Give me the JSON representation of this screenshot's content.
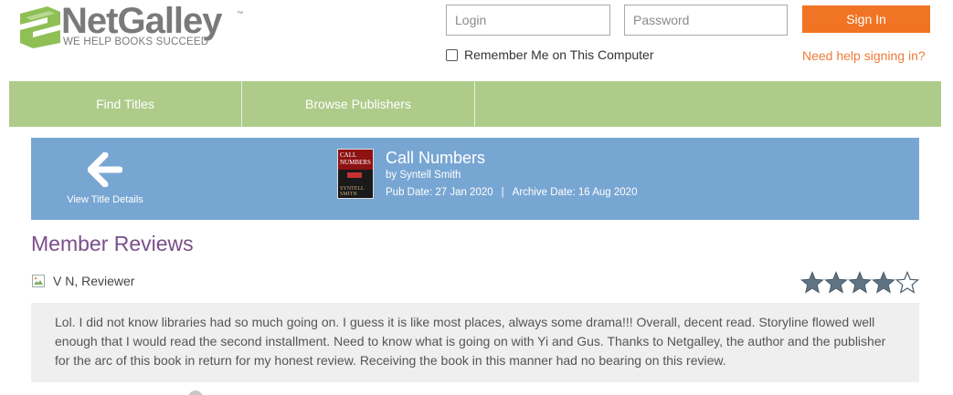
{
  "brand": {
    "name": "NetGalley",
    "tm": "™",
    "tagline": "WE HELP BOOKS SUCCEED",
    "color_text": "#7a7a7a",
    "color_mark": "#8fbf55"
  },
  "auth": {
    "login_placeholder": "Login",
    "password_placeholder": "Password",
    "signin_label": "Sign In",
    "remember_label": "Remember Me on This Computer",
    "remember_checked": false,
    "help_link": "Need help signing in?"
  },
  "nav": {
    "items": [
      {
        "label": "Find Titles"
      },
      {
        "label": "Browse Publishers"
      }
    ],
    "color": "#aecb8a"
  },
  "title_banner": {
    "back_label": "View Title Details",
    "book_title": "Call Numbers",
    "author": "by Syntell Smith",
    "pub_date": "Pub Date: 27 Jan 2020",
    "separator": "|",
    "archive_date": "Archive Date: 16 Aug 2020",
    "cover": {
      "title": "CALL NUMBERS",
      "author": "SYNTELL SMITH"
    },
    "color": "#78a6d3"
  },
  "reviews": {
    "heading": "Member Reviews",
    "items": [
      {
        "reviewer": "V N, Reviewer",
        "rating": 4,
        "max_rating": 5,
        "text": "Lol. I did not know libraries had so much going on. I guess it is like most places, always some drama!!!  Overall, decent read. Storyline flowed well enough that I would read the second installment. Need to know what is going on with Yi and Gus. Thanks to Netgalley, the author and the publisher for the arc of this book in return for my honest review. Receiving the book in this manner had no bearing on this review."
      }
    ]
  },
  "colors": {
    "accent": "#f07424",
    "heading": "#7a4f8a",
    "star": "#5f7383"
  }
}
